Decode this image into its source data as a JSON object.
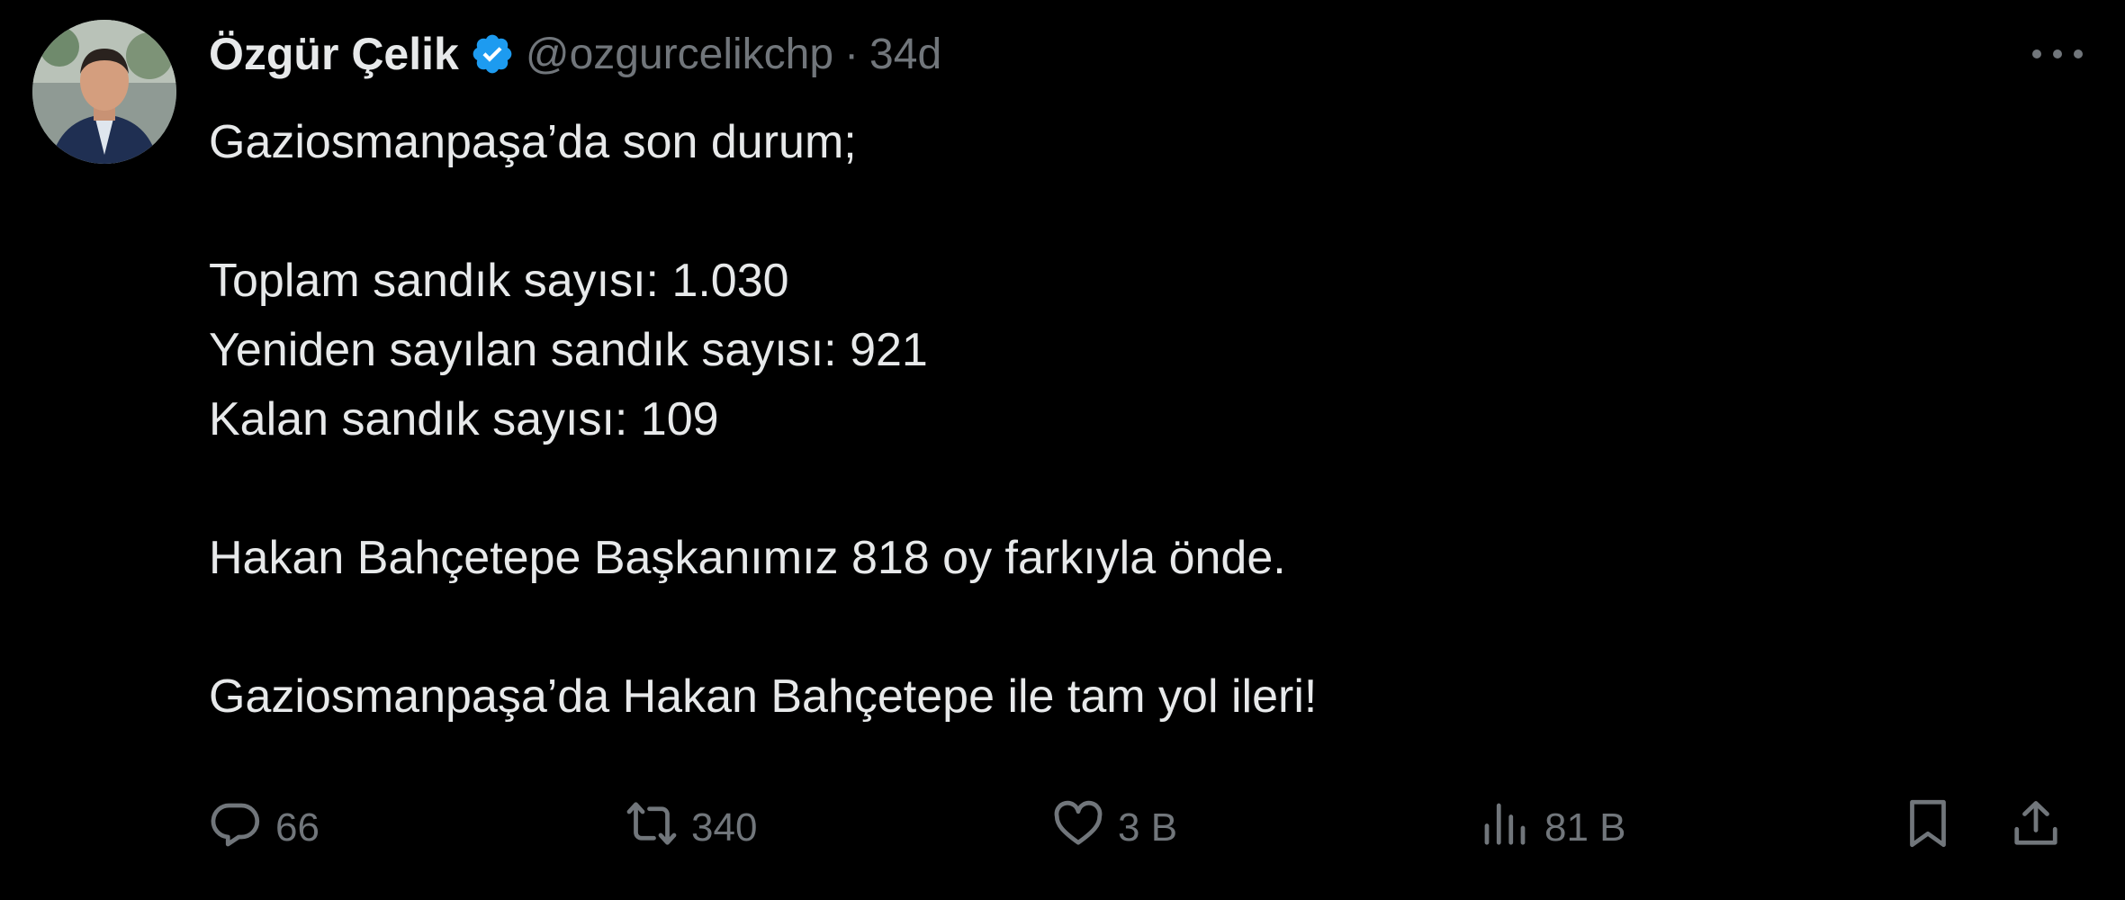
{
  "tweet": {
    "author": {
      "display_name": "Özgür Çelik",
      "handle": "@ozgurcelikchp",
      "verified": true
    },
    "separator": "·",
    "time": "34d",
    "text_lines": [
      "Gaziosmanpaşa’da son durum;",
      "",
      "Toplam sandık sayısı: 1.030",
      "Yeniden sayılan sandık sayısı: 921",
      "Kalan sandık sayısı: 109",
      "",
      "Hakan Bahçetepe Başkanımız 818 oy farkıyla önde.",
      "",
      "Gaziosmanpaşa’da Hakan Bahçetepe ile tam yol ileri!"
    ],
    "stats": {
      "replies": "66",
      "reposts": "340",
      "likes": "3 B",
      "views": "81 B"
    }
  },
  "icons": {
    "verified": "verified-badge-icon",
    "more": "more-icon",
    "reply": "reply-icon",
    "repost": "repost-icon",
    "like": "heart-icon",
    "views": "views-icon",
    "bookmark": "bookmark-icon",
    "share": "share-icon"
  },
  "colors": {
    "background": "#000000",
    "primary_text": "#e7e9ea",
    "secondary_text": "#71767b",
    "verified_blue": "#1d9bf0"
  }
}
